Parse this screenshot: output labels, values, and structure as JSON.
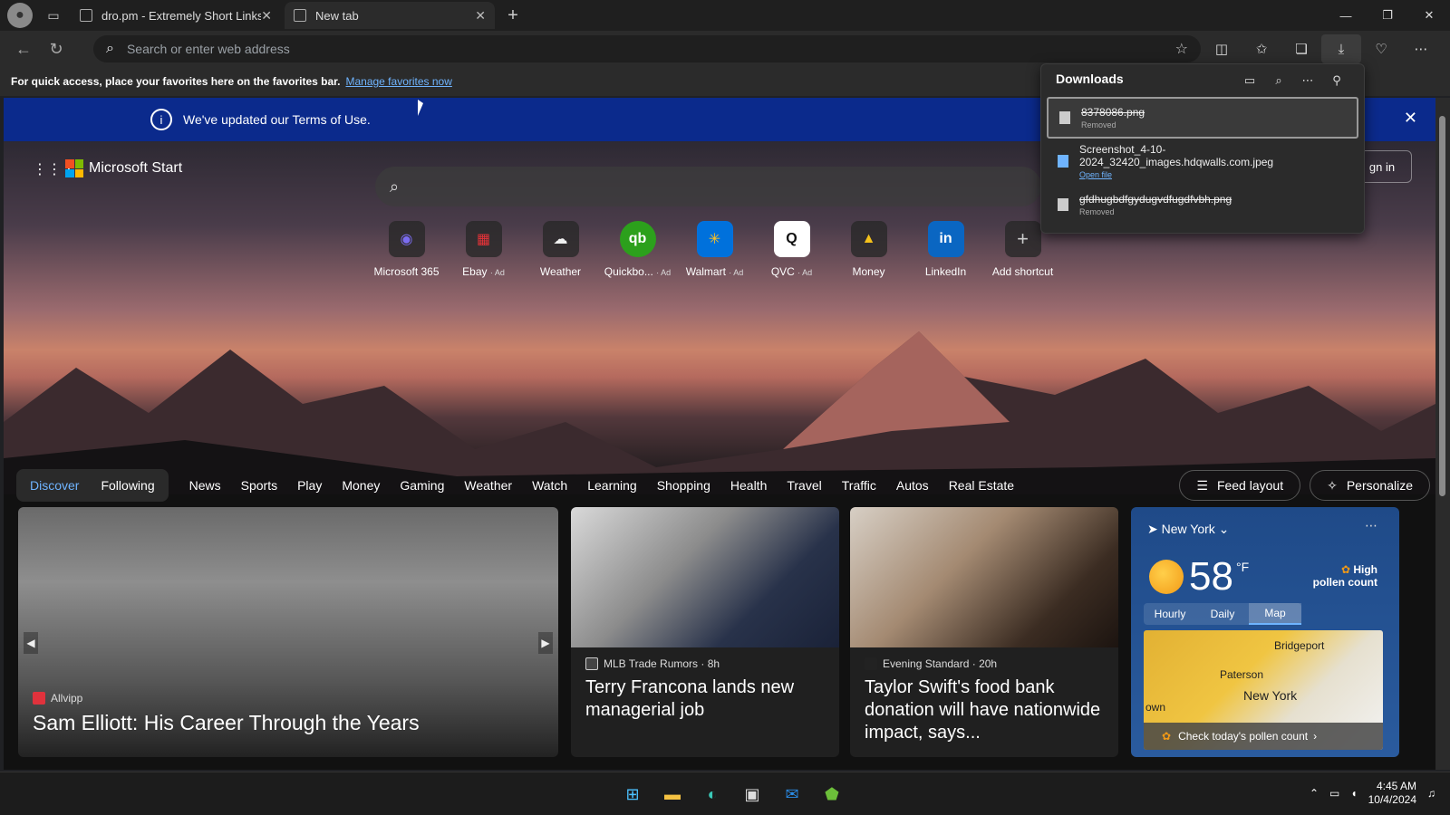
{
  "tabs": [
    {
      "title": "dro.pm - Extremely Short Links"
    },
    {
      "title": "New tab"
    }
  ],
  "address": {
    "placeholder": "Search or enter web address"
  },
  "favbar": {
    "text": "For quick access, place your favorites here on the favorites bar.",
    "link": "Manage favorites now"
  },
  "terms": {
    "text": "We've updated our Terms of Use."
  },
  "header": {
    "brand": "Microsoft Start",
    "signin": "gn in"
  },
  "shortcuts": [
    {
      "label": "Microsoft 365",
      "ad": "",
      "glyph": "◉",
      "color": "#7b6cf0"
    },
    {
      "label": "Ebay",
      "ad": "· Ad",
      "glyph": "▦",
      "color": "#e53238"
    },
    {
      "label": "Weather",
      "ad": "",
      "glyph": "☁",
      "color": "#f0f0f0"
    },
    {
      "label": "Quickbo...",
      "ad": "· Ad",
      "glyph": "qb",
      "color": "#2ca01c"
    },
    {
      "label": "Walmart",
      "ad": "· Ad",
      "glyph": "✳",
      "color": "#ffc220"
    },
    {
      "label": "QVC",
      "ad": "· Ad",
      "glyph": "Q",
      "color": "#ffffff"
    },
    {
      "label": "Money",
      "ad": "",
      "glyph": "▲",
      "color": "#f5c21b"
    },
    {
      "label": "LinkedIn",
      "ad": "",
      "glyph": "in",
      "color": "#0a66c2"
    },
    {
      "label": "Add shortcut",
      "ad": "",
      "glyph": "+",
      "color": "#cccccc"
    }
  ],
  "feed": {
    "pills": [
      "Discover",
      "Following"
    ],
    "categories": [
      "News",
      "Sports",
      "Play",
      "Money",
      "Gaming",
      "Weather",
      "Watch",
      "Learning",
      "Shopping",
      "Health",
      "Travel",
      "Traffic",
      "Autos",
      "Real Estate"
    ],
    "feed_layout": "Feed layout",
    "personalize": "Personalize"
  },
  "cards": [
    {
      "source": "Allvipp",
      "headline": "Sam Elliott: His Career Through the Years"
    },
    {
      "source": "MLB Trade Rumors · 8h",
      "headline": "Terry Francona lands new managerial job"
    },
    {
      "source": "Evening Standard · 20h",
      "headline": "Taylor Swift's food bank donation will have nationwide impact, says..."
    }
  ],
  "weather": {
    "location": "New York",
    "temp": "58",
    "unit": "°F",
    "pollen_line1": "High",
    "pollen_line2": "pollen count",
    "tabs": [
      "Hourly",
      "Daily",
      "Map"
    ],
    "towns": [
      "Bridgeport",
      "Paterson",
      "New York",
      "own"
    ],
    "check": "Check today's pollen count"
  },
  "downloads": {
    "title": "Downloads",
    "items": [
      {
        "name": "8378086.png",
        "status": "Removed"
      },
      {
        "name": "Screenshot_4-10-2024_32420_images.hdqwalls.com.jpeg",
        "status": "Open file"
      },
      {
        "name": "gfdhugbdfgydugvdfugdfvbh.png",
        "status": "Removed"
      }
    ]
  },
  "tray": {
    "time": "4:45 AM",
    "date": "10/4/2024"
  }
}
